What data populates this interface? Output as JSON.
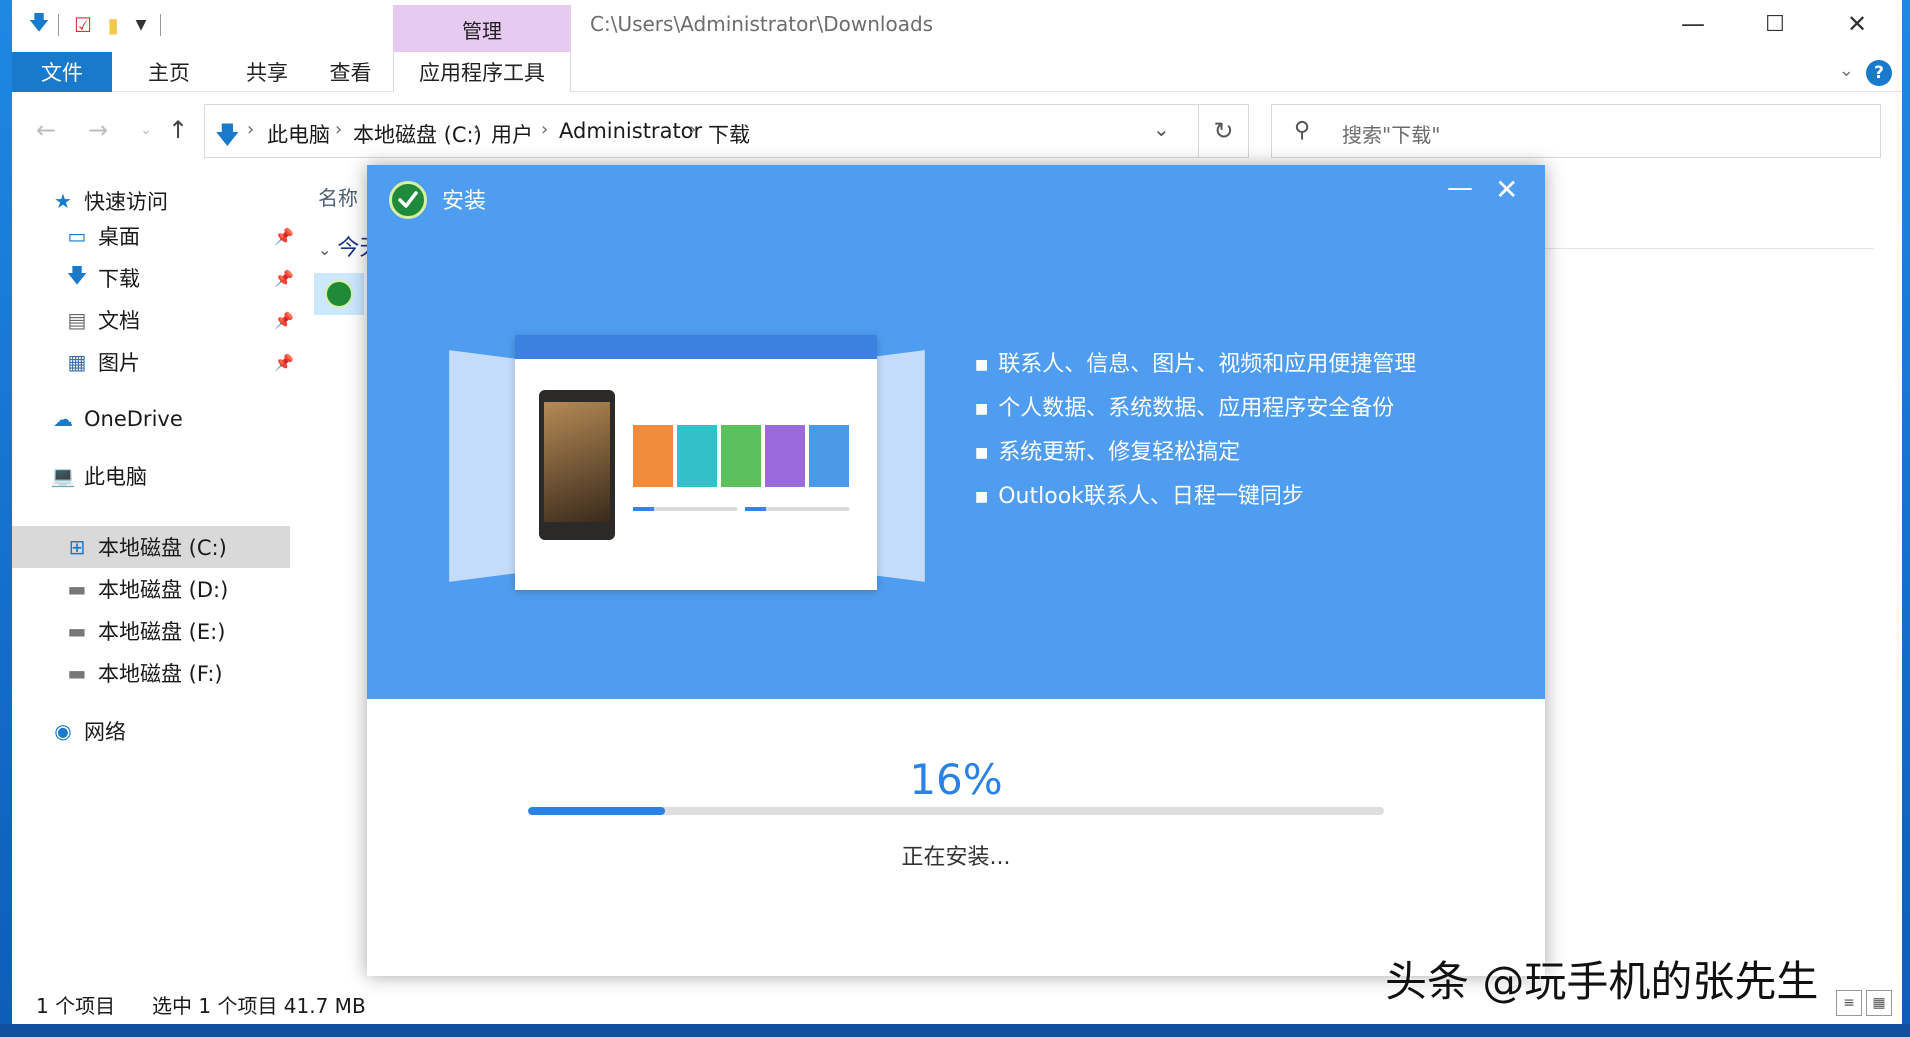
{
  "window": {
    "title_path": "C:\\Users\\Administrator\\Downloads",
    "manage_tab": "管理"
  },
  "ribbon": {
    "tabs": [
      "文件",
      "主页",
      "共享",
      "查看",
      "应用程序工具"
    ],
    "help": "?"
  },
  "address": {
    "crumbs": [
      "此电脑",
      "本地磁盘 (C:)",
      "用户",
      "Administrator",
      "下载"
    ],
    "search_placeholder": "搜索\"下载\""
  },
  "navpane": {
    "quick_access": "快速访问",
    "quick_items": [
      "桌面",
      "下载",
      "文档",
      "图片"
    ],
    "onedrive": "OneDrive",
    "this_pc": "此电脑",
    "drives": [
      "本地磁盘 (C:)",
      "本地磁盘 (D:)",
      "本地磁盘 (E:)",
      "本地磁盘 (F:)"
    ],
    "network": "网络"
  },
  "filelist": {
    "column_name": "名称",
    "group_header": "今天"
  },
  "statusbar": {
    "item_count": "1 个项目",
    "selection": "选中 1 个项目  41.7 MB"
  },
  "installer": {
    "title": "安装",
    "features": [
      "联系人、信息、图片、视频和应用便捷管理",
      "个人数据、系统数据、应用程序安全备份",
      "系统更新、修复轻松搞定",
      "Outlook联系人、日程一键同步"
    ],
    "progress": 0.16,
    "progress_label": "16%",
    "status": "正在安装..."
  },
  "watermark": "头条 @玩手机的张先生",
  "colors": {
    "accent": "#1979ca",
    "installer_blue": "#4f9df0",
    "progress_blue": "#2b82e6"
  }
}
